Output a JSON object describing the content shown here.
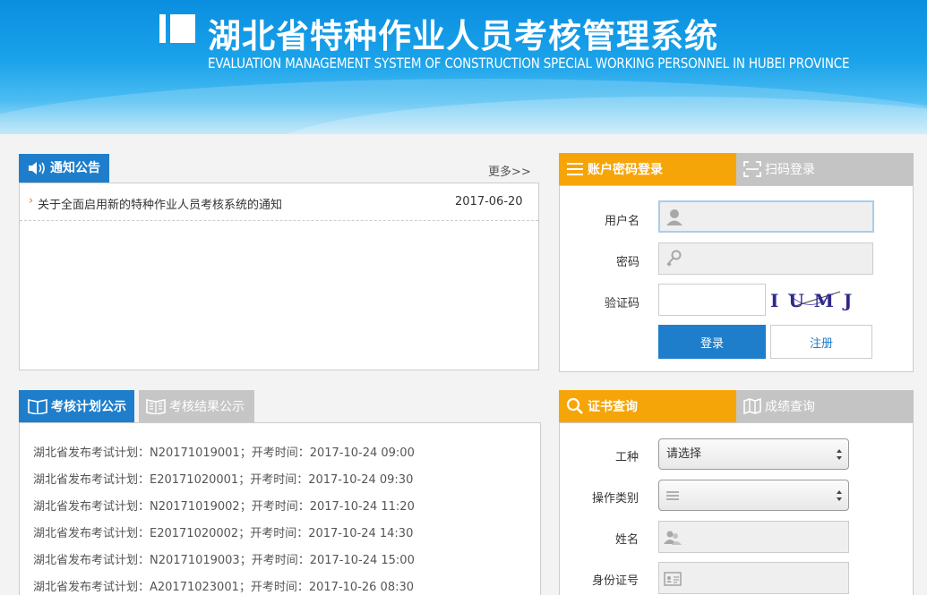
{
  "header": {
    "title_cn": "湖北省特种作业人员考核管理系统",
    "title_en": "EVALUATION MANAGEMENT SYSTEM OF CONSTRUCTION SPECIAL WORKING PERSONNEL IN HUBEI PROVINCE"
  },
  "notice": {
    "tab_label": "通知公告",
    "more_label": "更多>>",
    "items": [
      {
        "text": "关于全面启用新的特种作业人员考核系统的通知",
        "date": "2017-06-20"
      }
    ]
  },
  "plan": {
    "tab_active": "考核计划公示",
    "tab_inactive": "考核结果公示",
    "items": [
      "湖北省发布考试计划：N20171019001；开考时间：2017-10-24 09:00",
      "湖北省发布考试计划：E20171020001；开考时间：2017-10-24 09:30",
      "湖北省发布考试计划：N20171019002；开考时间：2017-10-24 11:20",
      "湖北省发布考试计划：E20171020002；开考时间：2017-10-24 14:30",
      "湖北省发布考试计划：N20171019003；开考时间：2017-10-24 15:00",
      "湖北省发布考试计划：A20171023001；开考时间：2017-10-26 08:30"
    ]
  },
  "login": {
    "tab_active": "账户密码登录",
    "tab_inactive": "扫码登录",
    "username_label": "用户名",
    "password_label": "密码",
    "captcha_label": "验证码",
    "captcha_text": "I U M J",
    "login_button": "登录",
    "register_button": "注册"
  },
  "query": {
    "tab_active": "证书查询",
    "tab_inactive": "成绩查询",
    "work_type_label": "工种",
    "work_type_value": "请选择",
    "operation_label": "操作类别",
    "operation_value": "",
    "name_label": "姓名",
    "id_label": "身份证号"
  },
  "colors": {
    "primary_blue": "#1e7ecb",
    "accent_orange": "#f6a508",
    "tab_gray": "#c4c4c4"
  }
}
